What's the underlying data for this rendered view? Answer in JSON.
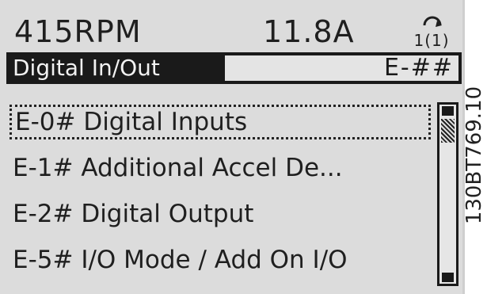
{
  "status_line": {
    "speed": "415RPM",
    "current": "11.8A",
    "setup_indicator": "1(1)"
  },
  "title_bar": {
    "menu_title": "Digital In/Out",
    "menu_code": "E-##"
  },
  "menu": {
    "items": [
      {
        "label": "E-0# Digital Inputs",
        "selected": true
      },
      {
        "label": "E-1# Additional Accel De...",
        "selected": false
      },
      {
        "label": "E-2# Digital Output",
        "selected": false
      },
      {
        "label": "E-5# I/O Mode / Add On I/O",
        "selected": false
      }
    ]
  },
  "scrollbar": {
    "position_fraction": 0.08
  },
  "figure_ref": "130BT769.10"
}
